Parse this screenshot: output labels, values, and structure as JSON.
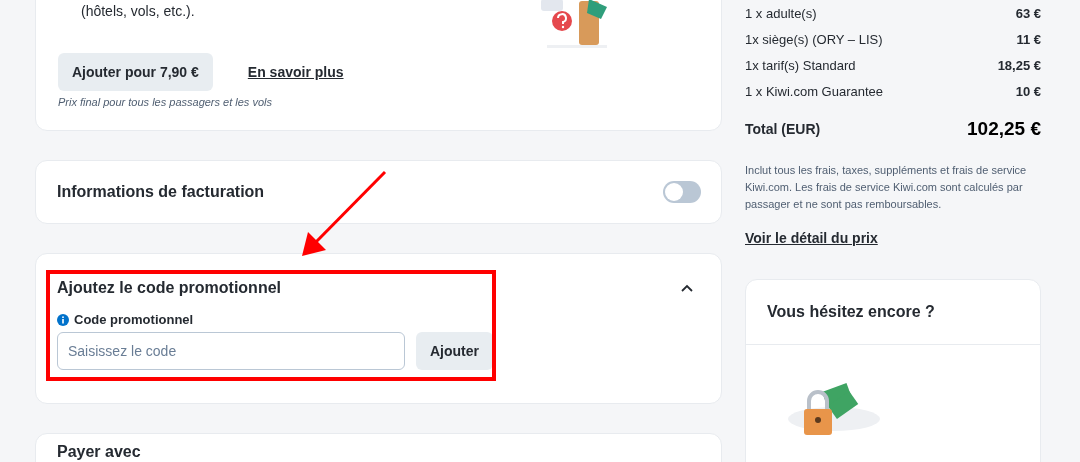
{
  "insurance_card": {
    "description_tail": "(hôtels, vols, etc.).",
    "add_button": "Ajouter pour 7,90 €",
    "learn_more_link": "En savoir plus",
    "note": "Prix final pour tous les passagers et les vols"
  },
  "billing_card": {
    "title": "Informations de facturation",
    "toggle_on": false
  },
  "promo_card": {
    "title": "Ajoutez le code promotionnel",
    "expanded": true,
    "field_label": "Code promotionnel",
    "placeholder": "Saisissez le code",
    "button": "Ajouter",
    "highlighted": true
  },
  "payment_card": {
    "title": "Payer avec"
  },
  "price_summary": {
    "lines": [
      {
        "label": "1 x adulte(s)",
        "amount": "63 €"
      },
      {
        "label": "1x siège(s) (ORY – LIS)",
        "amount": "11 €"
      },
      {
        "label": "1x tarif(s) Standard",
        "amount": "18,25 €"
      },
      {
        "label": "1 x Kiwi.com Guarantee",
        "amount": "10 €"
      }
    ],
    "total_label": "Total (EUR)",
    "total_amount": "102,25 €",
    "note": "Inclut tous les frais, taxes, suppléments et frais de service Kiwi.com. Les frais de service Kiwi.com sont calculés par passager et ne sont pas remboursables.",
    "details_link": "Voir le détail du prix"
  },
  "hesitate_card": {
    "title": "Vous hésitez encore ?"
  }
}
